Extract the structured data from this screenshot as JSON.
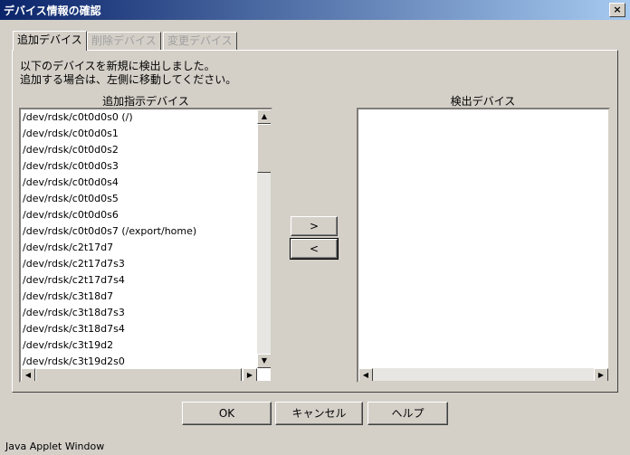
{
  "window": {
    "title": "デバイス情報の確認",
    "close": "×"
  },
  "tabs": [
    {
      "label": "追加デバイス",
      "state": "active"
    },
    {
      "label": "削除デバイス",
      "state": "disabled"
    },
    {
      "label": "変更デバイス",
      "state": "disabled"
    }
  ],
  "message": {
    "line1": "以下のデバイスを新規に検出しました。",
    "line2": "追加する場合は、左側に移動してください。"
  },
  "left_list": {
    "label": "追加指示デバイス",
    "items": [
      "/dev/rdsk/c0t0d0s0 (/)",
      "/dev/rdsk/c0t0d0s1",
      "/dev/rdsk/c0t0d0s2",
      "/dev/rdsk/c0t0d0s3",
      "/dev/rdsk/c0t0d0s4",
      "/dev/rdsk/c0t0d0s5",
      "/dev/rdsk/c0t0d0s6",
      "/dev/rdsk/c0t0d0s7 (/export/home)",
      "/dev/rdsk/c2t17d7",
      "/dev/rdsk/c2t17d7s3",
      "/dev/rdsk/c2t17d7s4",
      "/dev/rdsk/c3t18d7",
      "/dev/rdsk/c3t18d7s3",
      "/dev/rdsk/c3t18d7s4",
      "/dev/rdsk/c3t19d2",
      "/dev/rdsk/c3t19d2s0"
    ]
  },
  "right_list": {
    "label": "検出デバイス",
    "items": []
  },
  "move_buttons": {
    "right": ">",
    "left": "<"
  },
  "buttons": {
    "ok": "OK",
    "cancel": "キャンセル",
    "help": "ヘルプ"
  },
  "status": "Java Applet Window"
}
